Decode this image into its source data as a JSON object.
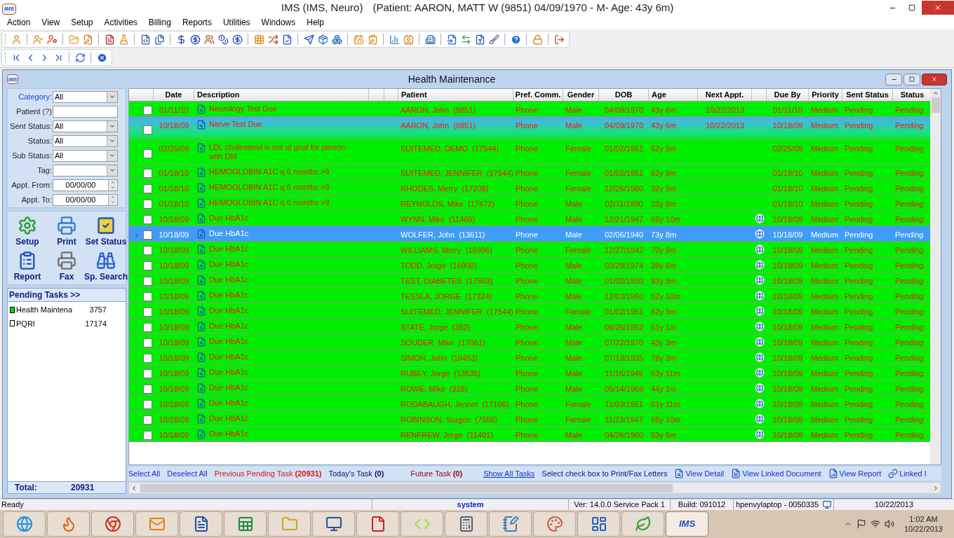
{
  "title_bar": {
    "logo": "IMS",
    "title": "IMS (IMS, Neuro)",
    "context": "(Patient: AARON, MATT W (9851) 04/09/1970 - M- Age: 43y 6m)"
  },
  "menu": [
    "Action",
    "View",
    "Setup",
    "Activities",
    "Billing",
    "Reports",
    "Utilities",
    "Windows",
    "Help"
  ],
  "window": {
    "logo": "IMS",
    "title": "Health Maintenance"
  },
  "filters": [
    {
      "kind": "dropdown",
      "label": "Category:",
      "value": "All",
      "highlighted": true
    },
    {
      "kind": "text",
      "label": "Patient",
      "hint": "(?)",
      "highlighted": false
    },
    {
      "kind": "dropdown",
      "label": "Sent Status:",
      "value": "All",
      "highlighted": false
    },
    {
      "kind": "dropdown",
      "label": "Status:",
      "value": "All",
      "highlighted": false
    },
    {
      "kind": "dropdown",
      "label": "Sub Status:",
      "value": "All",
      "highlighted": false
    },
    {
      "kind": "dropdown",
      "label": "Tag:",
      "highlighted": false
    },
    {
      "kind": "date",
      "label": "Appt. From:",
      "value": "00/00/00",
      "highlighted": false
    },
    {
      "kind": "date",
      "label": "Appt. To:",
      "value": "00/00/00",
      "highlighted": false
    }
  ],
  "actions": [
    "Setup",
    "Print",
    "Set Status",
    "Report",
    "Fax",
    "Sp. Search"
  ],
  "pending_tasks": {
    "title": "Pending Tasks >>",
    "items": [
      {
        "name": "Health Maintena",
        "count": "3757",
        "color": "#00dd00"
      },
      {
        "name": "PQRI",
        "count": "17174",
        "color": "#ffffff"
      }
    ]
  },
  "total": {
    "label": "Total:",
    "value": "20931"
  },
  "table": {
    "columns": [
      "Date",
      "Description",
      "Patient",
      "Pref. Comm.",
      "Gender",
      "DOB",
      "Age",
      "Next Appt.",
      "Due By",
      "Priority",
      "Sent Status",
      "Status"
    ],
    "rows": [
      {
        "checked": false,
        "selected": false,
        "focused": false,
        "linked": false,
        "date": "01/11/10",
        "description": "Neurology Test Due",
        "patient": "AARON, John  (9851)",
        "pref_comm": "Phone",
        "gender": "Male",
        "dob": "04/09/1970",
        "age": "43y 6m",
        "next_appt": "10/22/2013",
        "due_by": "01/11/10",
        "priority": "Medium",
        "sent_status": "Pending",
        "status": "Pending"
      },
      {
        "checked": false,
        "selected": false,
        "focused": true,
        "linked": false,
        "date": "10/18/09",
        "description": "Nerve Test Due",
        "patient": "AARON, John  (9851)",
        "pref_comm": "Phone",
        "gender": "Male",
        "dob": "04/09/1970",
        "age": "43y 6m",
        "next_appt": "10/22/2013",
        "due_by": "10/18/09",
        "priority": "Medium",
        "sent_status": "Pending",
        "status": "Pending"
      },
      {
        "checked": false,
        "selected": false,
        "focused": false,
        "linked": false,
        "date": "02/25/09",
        "description": "LDL cholesterol is not at goal for person with DM",
        "patient": "SUITEMED, DEMO  (17544)",
        "pref_comm": "Phone",
        "gender": "Female",
        "dob": "01/02/1951",
        "age": "62y 9m",
        "due_by": "02/25/09",
        "priority": "Medium",
        "sent_status": "Pending",
        "status": "Pending"
      },
      {
        "checked": false,
        "selected": false,
        "focused": false,
        "linked": false,
        "date": "01/18/10",
        "description": "HEMOGLOBIN A1C  q 6 months >9",
        "patient": "SUITEMED, JENNIFER  (17544)",
        "pref_comm": "Phone",
        "gender": "Female",
        "dob": "01/02/1951",
        "age": "62y 9m",
        "due_by": "01/18/10",
        "priority": "Medium",
        "sent_status": "Pending",
        "status": "Pending"
      },
      {
        "checked": false,
        "selected": false,
        "focused": false,
        "linked": false,
        "date": "01/18/10",
        "description": "HEMOGLOBIN A1C  q 6 months >9",
        "patient": "RHODES, Merry  (17208)",
        "pref_comm": "Phone",
        "gender": "Female",
        "dob": "12/26/1980",
        "age": "32y 9m",
        "due_by": "01/18/10",
        "priority": "Medium",
        "sent_status": "Pending",
        "status": "Pending"
      },
      {
        "checked": false,
        "selected": false,
        "focused": false,
        "linked": false,
        "date": "01/18/10",
        "description": "HEMOGLOBIN A1C  q 6 months >9",
        "patient": "REYNOLDS, Mike  (17472)",
        "pref_comm": "Phone",
        "gender": "Male",
        "dob": "02/11/1990",
        "age": "23y 8m",
        "due_by": "01/18/10",
        "priority": "Medium",
        "sent_status": "Pending",
        "status": "Pending"
      },
      {
        "checked": false,
        "selected": false,
        "focused": false,
        "linked": true,
        "date": "10/18/09",
        "description": "Due HbA1c",
        "patient": "WYNN, Mike  (11469)",
        "pref_comm": "Phone",
        "gender": "Male",
        "dob": "12/21/1947",
        "age": "65y 10m",
        "due_by": "10/18/09",
        "priority": "Medium",
        "sent_status": "Pending",
        "status": "Pending"
      },
      {
        "checked": false,
        "selected": true,
        "focused": false,
        "linked": true,
        "date": "10/18/09",
        "description": "Due HbA1c",
        "patient": "WOLFER, John  (13611)",
        "pref_comm": "Phone",
        "gender": "Male",
        "dob": "02/06/1940",
        "age": "73y 8m",
        "due_by": "10/18/09",
        "priority": "Medium",
        "sent_status": "Pending",
        "status": "Pending"
      },
      {
        "checked": false,
        "selected": false,
        "focused": false,
        "linked": true,
        "date": "10/18/09",
        "description": "Due HbA1c",
        "patient": "WILLIAMS, Merry  (16996)",
        "pref_comm": "Phone",
        "gender": "Female",
        "dob": "12/27/1942",
        "age": "70y 9m",
        "due_by": "10/18/09",
        "priority": "Medium",
        "sent_status": "Pending",
        "status": "Pending"
      },
      {
        "checked": false,
        "selected": false,
        "focused": false,
        "linked": true,
        "date": "10/18/09",
        "description": "Due HbA1c",
        "patient": "TODD, Jorge  (16900)",
        "pref_comm": "Phone",
        "gender": "Male",
        "dob": "03/29/1974",
        "age": "39y 6m",
        "due_by": "10/18/09",
        "priority": "Medium",
        "sent_status": "Pending",
        "status": "Pending"
      },
      {
        "checked": false,
        "selected": false,
        "focused": false,
        "linked": true,
        "date": "10/18/09",
        "description": "Due HbA1c",
        "patient": "TEST, DIABETES  (17563)",
        "pref_comm": "Phone",
        "gender": "Male",
        "dob": "01/02/1930",
        "age": "83y 9m",
        "due_by": "10/18/09",
        "priority": "Medium",
        "sent_status": "Pending",
        "status": "Pending"
      },
      {
        "checked": false,
        "selected": false,
        "focused": false,
        "linked": true,
        "date": "10/18/09",
        "description": "Due HbA1c",
        "patient": "TESSLA, JORGE  (17324)",
        "pref_comm": "Phone",
        "gender": "Male",
        "dob": "12/03/1960",
        "age": "52y 10m",
        "due_by": "10/18/09",
        "priority": "Medium",
        "sent_status": "Pending",
        "status": "Pending"
      },
      {
        "checked": false,
        "selected": false,
        "focused": false,
        "linked": true,
        "date": "10/18/09",
        "description": "Due HbA1c",
        "patient": "SUITEMED, JENNIFER  (17544)",
        "pref_comm": "Phone",
        "gender": "Female",
        "dob": "01/02/1951",
        "age": "62y 9m",
        "due_by": "10/18/09",
        "priority": "Medium",
        "sent_status": "Pending",
        "status": "Pending"
      },
      {
        "checked": false,
        "selected": false,
        "focused": false,
        "linked": true,
        "date": "10/18/09",
        "description": "Due HbA1c",
        "patient": "STATE, Jorge  (382)",
        "pref_comm": "Phone",
        "gender": "Male",
        "dob": "08/26/1952",
        "age": "61y 1m",
        "due_by": "10/18/09",
        "priority": "Medium",
        "sent_status": "Pending",
        "status": "Pending"
      },
      {
        "checked": false,
        "selected": false,
        "focused": false,
        "linked": true,
        "date": "10/18/09",
        "description": "Due HbA1c",
        "patient": "SOUDER, Mike  (17061)",
        "pref_comm": "Phone",
        "gender": "Male",
        "dob": "07/22/1970",
        "age": "43y 3m",
        "due_by": "10/18/09",
        "priority": "Medium",
        "sent_status": "Pending",
        "status": "Pending"
      },
      {
        "checked": false,
        "selected": false,
        "focused": false,
        "linked": true,
        "date": "10/18/09",
        "description": "Due HbA1c",
        "patient": "SIMON, John  (10453)",
        "pref_comm": "Phone",
        "gender": "Male",
        "dob": "07/13/1935",
        "age": "78y 3m",
        "due_by": "10/18/09",
        "priority": "Medium",
        "sent_status": "Pending",
        "status": "Pending"
      },
      {
        "checked": false,
        "selected": false,
        "focused": false,
        "linked": true,
        "date": "10/18/09",
        "description": "Due HbA1c",
        "patient": "RUBEY, Jorge  (13535)",
        "pref_comm": "Phone",
        "gender": "Male",
        "dob": "11/16/1949",
        "age": "63y 11m",
        "due_by": "10/18/09",
        "priority": "Medium",
        "sent_status": "Pending",
        "status": "Pending"
      },
      {
        "checked": false,
        "selected": false,
        "focused": false,
        "linked": true,
        "date": "10/18/09",
        "description": "Due HbA1c",
        "patient": "ROWE, Mike  (328)",
        "pref_comm": "Phone",
        "gender": "Male",
        "dob": "09/14/1969",
        "age": "44y 1m",
        "due_by": "10/18/09",
        "priority": "Medium",
        "sent_status": "Pending",
        "status": "Pending"
      },
      {
        "checked": false,
        "selected": false,
        "focused": false,
        "linked": true,
        "date": "10/18/09",
        "description": "Due HbA1c",
        "patient": "RODABAUGH, Jennet  (17166)",
        "pref_comm": "Phone",
        "gender": "Female",
        "dob": "11/03/1951",
        "age": "61y 11m",
        "due_by": "10/18/09",
        "priority": "Medium",
        "sent_status": "Pending",
        "status": "Pending"
      },
      {
        "checked": false,
        "selected": false,
        "focused": false,
        "linked": true,
        "date": "10/18/09",
        "description": "Due HbA1c",
        "patient": "ROBINSON, Surgon  (7656)",
        "pref_comm": "Phone",
        "gender": "Female",
        "dob": "11/23/1947",
        "age": "65y 10m",
        "due_by": "10/18/09",
        "priority": "Medium",
        "sent_status": "Pending",
        "status": "Pending"
      },
      {
        "checked": false,
        "selected": false,
        "focused": false,
        "linked": true,
        "date": "10/18/09",
        "description": "Due HbA1c",
        "patient": "RENFREW, Jorge  (11401)",
        "pref_comm": "Phone",
        "gender": "Male",
        "dob": "04/26/1960",
        "age": "53y 5m",
        "due_by": "10/18/09",
        "priority": "Medium",
        "sent_status": "Pending",
        "status": "Pending"
      }
    ]
  },
  "task_bar": [
    {
      "kind": "link",
      "text": "Select All"
    },
    {
      "kind": "link",
      "text": "Deselect All"
    },
    {
      "kind": "alert",
      "text": "Previous Pending Task **(20931)**"
    },
    {
      "kind": "count",
      "text": "Today's Task **(0)**"
    },
    {
      "kind": "future",
      "text": "Future Task **(0)**"
    },
    {
      "kind": "underlined",
      "text": "Show All Tasks"
    },
    {
      "kind": "note",
      "text": "Select check box to Print/Fax Letters"
    },
    {
      "kind": "icon_link",
      "text": "View Detail"
    },
    {
      "kind": "icon_link",
      "text": "View Linked Document"
    },
    {
      "kind": "icon_link",
      "text": "View Report"
    },
    {
      "kind": "icon_link",
      "text": "Linked I"
    }
  ],
  "status_bar": {
    "message": "Ready",
    "user": "system",
    "version": "Ver: 14.0.0 Service Pack 1",
    "build": "Build: 091012",
    "machine": "hpenvylaptop - 0050335",
    "date": "10/22/2013"
  },
  "taskbar": {
    "active_logo": "IMS",
    "time": "1:02 AM",
    "date": "10/22/2013"
  }
}
